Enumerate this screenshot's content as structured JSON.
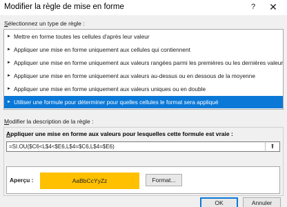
{
  "window": {
    "title": "Modifier la règle de mise en forme",
    "help": "?",
    "close": "✕"
  },
  "rule_type": {
    "label_prefix": "S",
    "label_rest": "électionnez un type de règle :",
    "items": [
      {
        "label": "Mettre en forme toutes les cellules d'après leur valeur",
        "selected": false
      },
      {
        "label": "Appliquer une mise en forme uniquement aux cellules qui contiennent",
        "selected": false
      },
      {
        "label": "Appliquer une mise en forme uniquement aux valeurs rangées parmi les premières ou les dernières valeurs",
        "selected": false
      },
      {
        "label": "Appliquer une mise en forme uniquement aux valeurs au-dessus ou en dessous de la moyenne",
        "selected": false
      },
      {
        "label": "Appliquer une mise en forme uniquement aux valeurs uniques ou en double",
        "selected": false
      },
      {
        "label": "Utiliser une formule pour déterminer pour quelles cellules le format sera appliqué",
        "selected": true
      }
    ],
    "arrow": "►"
  },
  "description": {
    "label_prefix": "M",
    "label_rest": "odifier la description de la règle :",
    "heading_prefix": "A",
    "heading_rest": "ppliquer une mise en forme aux valeurs pour lesquelles cette formule est vraie :",
    "formula": "=SI.OU($C6<L$4<$E6,L$4=$C6,L$4=$E6)",
    "collapse_icon": "⭱"
  },
  "preview": {
    "label": "Aperçu :",
    "sample": "AaBbCcYyZz",
    "sample_color": "#ffc000",
    "format_button": "Format..."
  },
  "buttons": {
    "ok": "OK",
    "cancel": "Annuler"
  }
}
